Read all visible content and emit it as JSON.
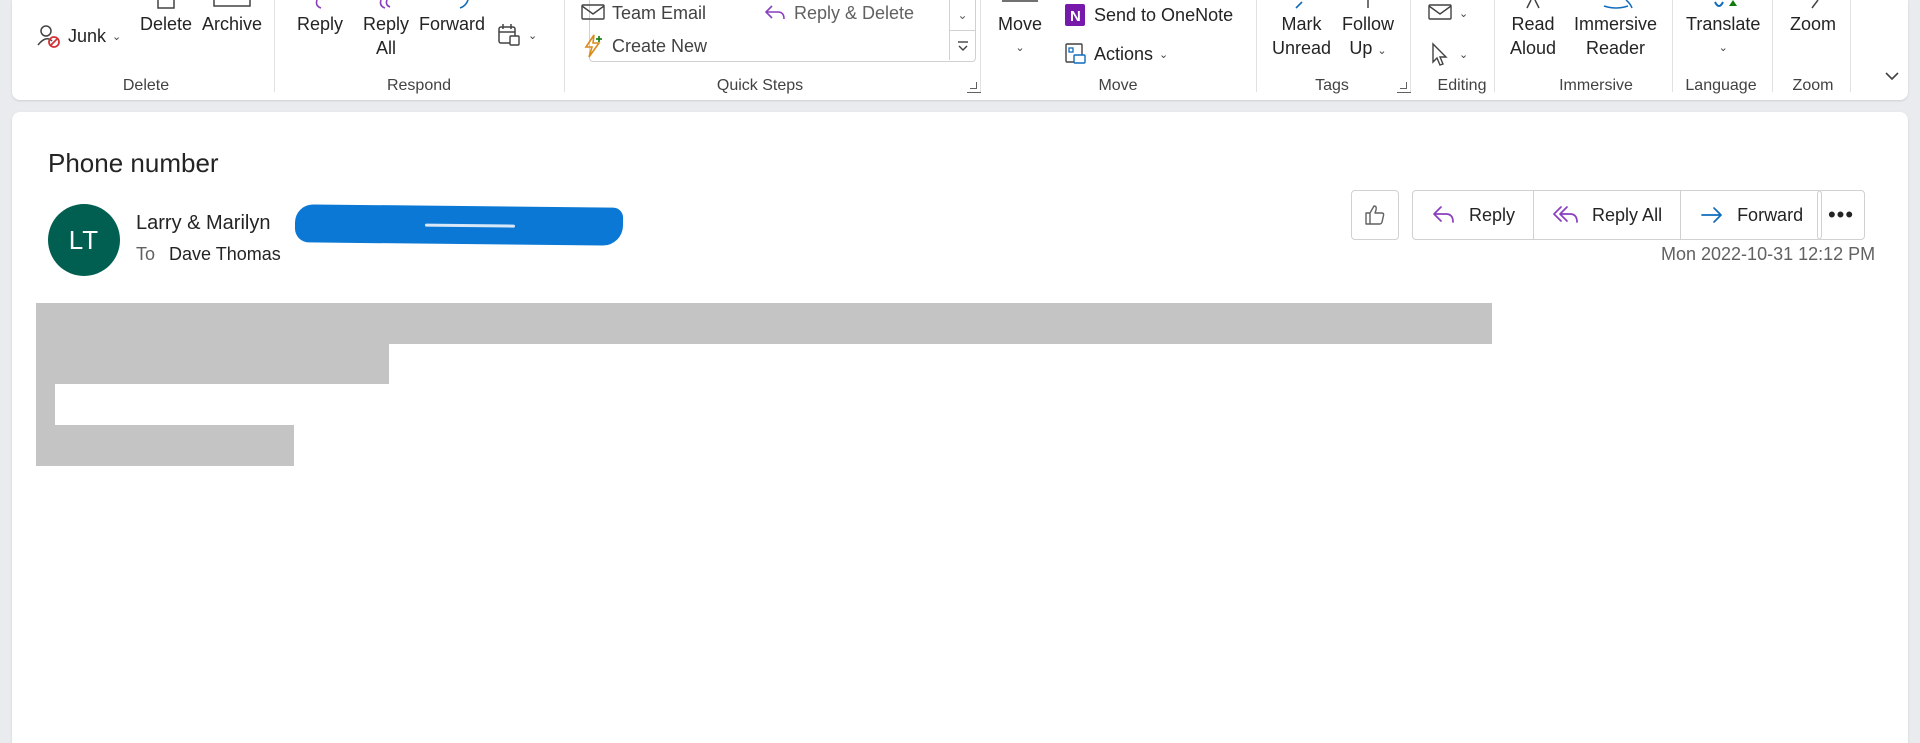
{
  "ribbon": {
    "delete_group": {
      "junk": "Junk",
      "delete": "Delete",
      "archive": "Archive",
      "label": "Delete"
    },
    "respond_group": {
      "reply": "Reply",
      "reply_all_1": "Reply",
      "reply_all_2": "All",
      "forward": "Forward",
      "label": "Respond"
    },
    "quick_steps": {
      "team_email": "Team Email",
      "create_new": "Create New",
      "reply_delete": "Reply & Delete",
      "label": "Quick Steps"
    },
    "move_group": {
      "move": "Move",
      "send_onenote": "Send to OneNote",
      "actions": "Actions",
      "label": "Move"
    },
    "tags_group": {
      "mark_1": "Mark",
      "mark_2": "Unread",
      "follow_1": "Follow",
      "follow_2": "Up",
      "label": "Tags"
    },
    "editing_group": {
      "label": "Editing"
    },
    "immersive_group": {
      "read_1": "Read",
      "read_2": "Aloud",
      "imm_1": "Immersive",
      "imm_2": "Reader",
      "label": "Immersive"
    },
    "language_group": {
      "translate": "Translate",
      "label": "Language"
    },
    "zoom_group": {
      "zoom": "Zoom",
      "label": "Zoom"
    }
  },
  "message": {
    "subject": "Phone number",
    "avatar_initials": "LT",
    "sender": "Larry & Marilyn",
    "to_label": "To",
    "recipient": "Dave Thomas",
    "timestamp": "Mon 2022-10-31 12:12 PM",
    "actions": {
      "reply": "Reply",
      "reply_all": "Reply All",
      "forward": "Forward"
    }
  },
  "colors": {
    "avatar": "#005f50",
    "accent_blue": "#0f6cbd",
    "accent_purple": "#8a3fbf",
    "redaction": "#0a78d4",
    "redaction_gray": "#c4c4c4"
  }
}
